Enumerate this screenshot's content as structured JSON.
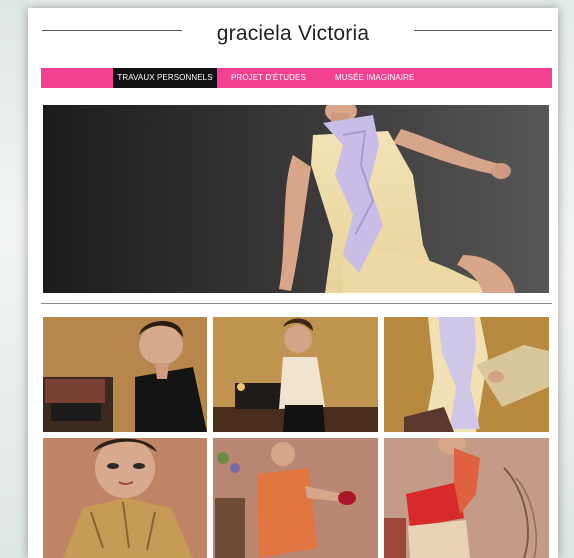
{
  "site": {
    "title": "graciela Victoria"
  },
  "nav": {
    "items": [
      {
        "label": "TRAVAUX PERSONNELS",
        "active": true
      },
      {
        "label": "PROJET D'ÉTUDES",
        "active": false
      },
      {
        "label": "MUSÉE IMAGINAIRE",
        "active": false
      }
    ]
  },
  "colors": {
    "nav_bg": "#f4418f",
    "nav_active_bg": "#111111",
    "title_text": "#222222"
  },
  "gallery": {
    "hero": {
      "subject": "model in yellow dress with lavender ruffle"
    },
    "thumbnails": [
      {
        "subject": "model in black coat with typewriter"
      },
      {
        "subject": "model in cream blouse with typewriter"
      },
      {
        "subject": "model in lavender top holding clutch"
      },
      {
        "subject": "portrait with gold ruffled collar"
      },
      {
        "subject": "model in orange dress holding red clutch"
      },
      {
        "subject": "model in red top with orange scarf"
      }
    ]
  }
}
